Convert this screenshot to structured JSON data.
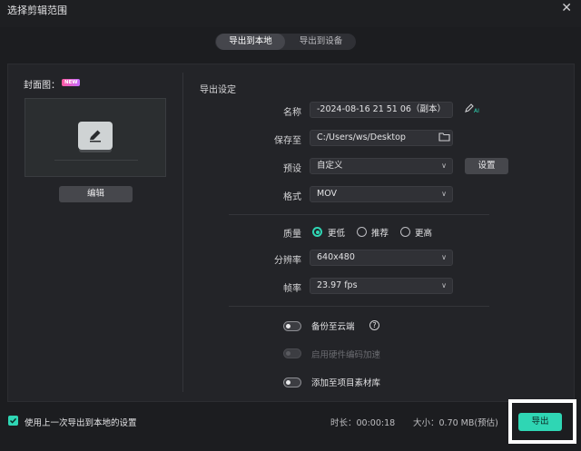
{
  "window": {
    "title": "选择剪辑范围"
  },
  "tabs": [
    {
      "label": "导出到本地"
    },
    {
      "label": "导出到设备"
    }
  ],
  "cover": {
    "label": "封面图：",
    "badge": "NEW",
    "edit_label": "编辑"
  },
  "settings": {
    "title": "导出设定",
    "name": {
      "label": "名称",
      "value": "-2024-08-16 21 51 06（副本）"
    },
    "save_to": {
      "label": "保存至",
      "value": "C:/Users/ws/Desktop"
    },
    "preset": {
      "label": "预设",
      "value": "自定义",
      "button": "设置"
    },
    "format": {
      "label": "格式",
      "value": "MOV"
    },
    "quality": {
      "label": "质量",
      "options": [
        "更低",
        "推荐",
        "更高"
      ],
      "selected": "更低"
    },
    "resolution": {
      "label": "分辨率",
      "value": "640x480"
    },
    "frame_rate": {
      "label": "帧率",
      "value": "23.97 fps"
    },
    "backup": {
      "label": "备份至云端",
      "enabled": false
    },
    "hardware": {
      "label": "启用硬件编码加速",
      "enabled": false,
      "disabled": true
    },
    "add_library": {
      "label": "添加至项目素材库",
      "enabled": false
    }
  },
  "footer": {
    "use_last_label": "使用上一次导出到本地的设置",
    "use_last_checked": true,
    "duration": "时长：00:00:18",
    "size": "大小：0.70 MB(预估)",
    "export_label": "导出"
  },
  "colors": {
    "accent": "#2fd6b4",
    "background": "#1c1d20",
    "panel": "#232428"
  }
}
